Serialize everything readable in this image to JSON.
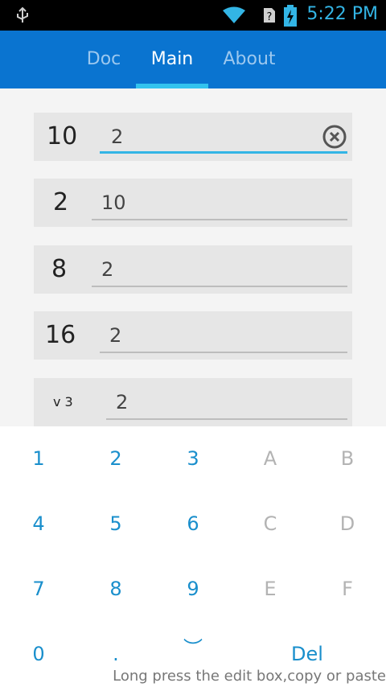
{
  "status_bar": {
    "time": "5:22 PM"
  },
  "tabs": [
    {
      "label": "Doc"
    },
    {
      "label": "Main"
    },
    {
      "label": "About"
    }
  ],
  "rows": [
    {
      "base": "10",
      "value": "2"
    },
    {
      "base": "2",
      "value": "10"
    },
    {
      "base": "8",
      "value": "2"
    },
    {
      "base": "16",
      "value": "2"
    },
    {
      "base": "v 3",
      "value": "2"
    }
  ],
  "keypad": {
    "row1": [
      "1",
      "2",
      "3",
      "A",
      "B"
    ],
    "row2": [
      "4",
      "5",
      "6",
      "C",
      "D"
    ],
    "row3": [
      "7",
      "8",
      "9",
      "E",
      "F"
    ],
    "row4": [
      "0",
      ".",
      "︶",
      "Del"
    ]
  },
  "hint": "Long press the edit box,copy or paste",
  "colors": {
    "accent": "#33b5e5",
    "tabbar": "#0a74d0",
    "keypad_active": "#1a8fcc",
    "keypad_disabled": "#b3b3b3"
  }
}
